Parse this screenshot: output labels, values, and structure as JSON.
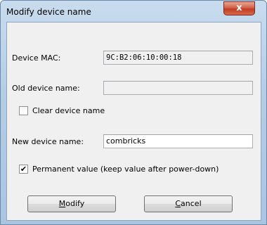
{
  "window": {
    "title": "Modify device name",
    "close_glyph": "x"
  },
  "form": {
    "mac_label": "Device MAC:",
    "mac_value": "9C:B2:06:10:00:18",
    "old_name_label": "Old device name:",
    "old_name_value": "",
    "clear_label": "Clear device name",
    "clear_checked": false,
    "new_name_label": "New device name:",
    "new_name_value": "combricks",
    "permanent_label": "Permanent value (keep value after power-down)",
    "permanent_checked": true
  },
  "buttons": {
    "modify_mnemonic": "M",
    "modify_rest": "odify",
    "cancel_mnemonic": "C",
    "cancel_rest": "ancel"
  },
  "icons": {
    "close": "close-icon",
    "check": "check-icon"
  },
  "colors": {
    "close_button": "#c23c22",
    "dialog_background": "#f0f0f0",
    "frame": "#b4cde6"
  }
}
